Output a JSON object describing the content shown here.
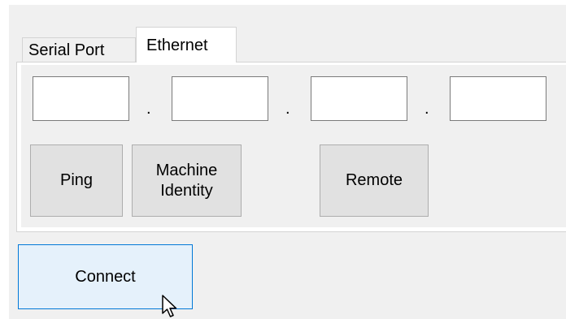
{
  "tabs": [
    {
      "label": "Serial Port",
      "selected": false
    },
    {
      "label": "Ethernet",
      "selected": true
    }
  ],
  "ethernet": {
    "ip_octets": [
      "",
      "",
      "",
      ""
    ],
    "separator": ".",
    "ping_label": "Ping",
    "machine_identity_label_line1": "Machine",
    "machine_identity_label_line2": "Identity",
    "remote_label": "Remote"
  },
  "connect_label": "Connect",
  "colors": {
    "window_bg": "#f0f0f0",
    "panel_bg": "#ffffff",
    "button_bg": "#e1e1e1",
    "button_border": "#adadad",
    "focus_bg": "#e5f1fb",
    "focus_border": "#0078d7"
  },
  "icons": {
    "cursor": "arrow-cursor-icon"
  }
}
